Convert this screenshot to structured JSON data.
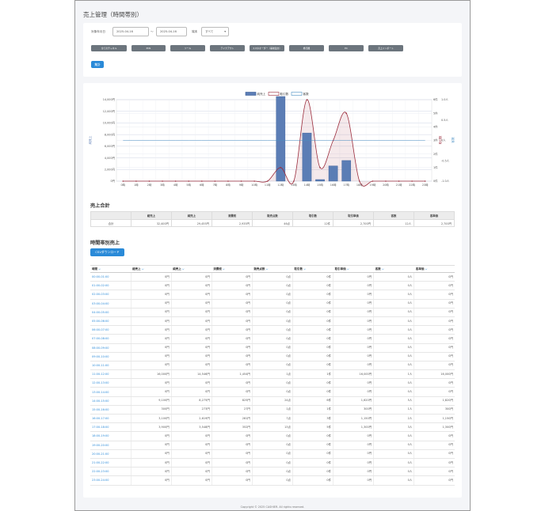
{
  "page": {
    "title": "売上管理（時間帯別）",
    "footer": "Copyright © 2025 CASHIER. All rights reserved."
  },
  "filters": {
    "date_label": "対象年月日",
    "date_from": "2025-04-16",
    "separator": "〜",
    "date_to": "2025-04-16",
    "store_label": "端末",
    "store_value": "すべて",
    "chips": [
      "全てのチャネル",
      "POS",
      "ツール",
      "テイクアウト",
      "スマホオーダー（事前注文）",
      "券売機",
      "EC",
      "売上インポート"
    ],
    "aggregate_button": "集計"
  },
  "chart_data": {
    "type": "bar",
    "categories": [
      "0時",
      "1時",
      "2時",
      "3時",
      "4時",
      "5時",
      "6時",
      "7時",
      "8時",
      "9時",
      "10時",
      "11時",
      "12時",
      "13時",
      "14時",
      "15時",
      "16時",
      "17時",
      "18時",
      "19時",
      "20時",
      "21時",
      "22時",
      "23時"
    ],
    "series": [
      {
        "name": "純売上",
        "type": "bar",
        "color": "#5b7db5",
        "values": [
          0,
          0,
          0,
          0,
          0,
          0,
          0,
          0,
          0,
          0,
          0,
          0,
          14546,
          0,
          8275,
          273,
          2619,
          3548,
          0,
          0,
          0,
          0,
          0,
          0
        ]
      },
      {
        "name": "取引数",
        "type": "line",
        "color": "#9b2c3c",
        "values": [
          0,
          0,
          0,
          0,
          0,
          0,
          0,
          0,
          0,
          0,
          0,
          0,
          1,
          0,
          6,
          1,
          3,
          5,
          0,
          0,
          0,
          0,
          0,
          0
        ]
      },
      {
        "name": "客数",
        "type": "line",
        "color": "#4a90c4",
        "values": [
          0,
          0,
          0,
          0,
          0,
          0,
          0,
          0,
          0,
          0,
          0,
          0,
          0,
          0,
          0,
          0,
          0,
          0,
          0,
          0,
          0,
          0,
          0,
          0
        ]
      }
    ],
    "legend_position": "top",
    "y_left": {
      "label": "純売上",
      "ticks": [
        "0円",
        "2,000円",
        "4,000円",
        "6,000円",
        "8,000円",
        "10,000円",
        "12,000円",
        "14,000円"
      ],
      "max": 14000
    },
    "y_right1": {
      "label": "取引数",
      "ticks": [
        "0件",
        "1件",
        "2件",
        "3件",
        "4件",
        "5件",
        "6件"
      ],
      "max": 6
    },
    "y_right2": {
      "label": "客数",
      "ticks": [
        "-1.0人",
        "-0.5人",
        "0人",
        "0.5人",
        "1.0人"
      ],
      "min": -1,
      "max": 1
    }
  },
  "summary": {
    "title": "売上合計",
    "headers": [
      "",
      "総売上",
      "純売上",
      "消費税",
      "販売点数",
      "取引数",
      "取引単価",
      "客数",
      "客単価"
    ],
    "row": [
      "合計",
      "32,400円",
      "29,455円",
      "2,935円",
      "46点",
      "12件",
      "2,700円",
      "12人",
      "2,700円"
    ]
  },
  "hourly": {
    "title": "時間帯別売上",
    "csv_button": "CSVダウンロード",
    "headers": [
      "時間",
      "総売上",
      "純売上",
      "消費税",
      "販売点数",
      "取引数",
      "取引単価",
      "客数",
      "客単価"
    ],
    "rows": [
      [
        "00:00-01:00",
        "0円",
        "0円",
        "0円",
        "0点",
        "0件",
        "0円",
        "0人",
        "0円"
      ],
      [
        "01:00-02:00",
        "0円",
        "0円",
        "0円",
        "0点",
        "0件",
        "0円",
        "0人",
        "0円"
      ],
      [
        "02:00-03:00",
        "0円",
        "0円",
        "0円",
        "0点",
        "0件",
        "0円",
        "0人",
        "0円"
      ],
      [
        "03:00-04:00",
        "0円",
        "0円",
        "0円",
        "0点",
        "0件",
        "0円",
        "0人",
        "0円"
      ],
      [
        "04:00-05:00",
        "0円",
        "0円",
        "0円",
        "0点",
        "0件",
        "0円",
        "0人",
        "0円"
      ],
      [
        "05:00-06:00",
        "0円",
        "0円",
        "0円",
        "0点",
        "0件",
        "0円",
        "0人",
        "0円"
      ],
      [
        "06:00-07:00",
        "0円",
        "0円",
        "0円",
        "0点",
        "0件",
        "0円",
        "0人",
        "0円"
      ],
      [
        "07:00-08:00",
        "0円",
        "0円",
        "0円",
        "0点",
        "0件",
        "0円",
        "0人",
        "0円"
      ],
      [
        "08:00-09:00",
        "0円",
        "0円",
        "0円",
        "0点",
        "0件",
        "0円",
        "0人",
        "0円"
      ],
      [
        "09:00-10:00",
        "0円",
        "0円",
        "0円",
        "0点",
        "0件",
        "0円",
        "0人",
        "0円"
      ],
      [
        "10:00-11:00",
        "0円",
        "0円",
        "0円",
        "0点",
        "0件",
        "0円",
        "0人",
        "0円"
      ],
      [
        "11:00-12:00",
        "16,000円",
        "14,546円",
        "1,454円",
        "1点",
        "1件",
        "16,000円",
        "1人",
        "16,000円"
      ],
      [
        "12:00-13:00",
        "0円",
        "0円",
        "0円",
        "0点",
        "0件",
        "0円",
        "0人",
        "0円"
      ],
      [
        "13:00-14:00",
        "0円",
        "0円",
        "0円",
        "0点",
        "0件",
        "0円",
        "0人",
        "0円"
      ],
      [
        "14:00-15:00",
        "9,100円",
        "8,275円",
        "825円",
        "24点",
        "6件",
        "1,620円",
        "5人",
        "1,820円"
      ],
      [
        "15:00-16:00",
        "300円",
        "273円",
        "27円",
        "1点",
        "1件",
        "300円",
        "1人",
        "300円"
      ],
      [
        "16:00-17:00",
        "3,100円",
        "2,619円",
        "281円",
        "7点",
        "3件",
        "1,150円",
        "2人",
        "1,150円"
      ],
      [
        "17:00-18:00",
        "3,900円",
        "3,548円",
        "352円",
        "13点",
        "5件",
        "1,300円",
        "3人",
        "1,300円"
      ],
      [
        "18:00-19:00",
        "0円",
        "0円",
        "0円",
        "0点",
        "0件",
        "0円",
        "0人",
        "0円"
      ],
      [
        "19:00-20:00",
        "0円",
        "0円",
        "0円",
        "0点",
        "0件",
        "0円",
        "0人",
        "0円"
      ],
      [
        "20:00-21:00",
        "0円",
        "0円",
        "0円",
        "0点",
        "0件",
        "0円",
        "0人",
        "0円"
      ],
      [
        "21:00-22:00",
        "0円",
        "0円",
        "0円",
        "0点",
        "0件",
        "0円",
        "0人",
        "0円"
      ],
      [
        "22:00-23:00",
        "0円",
        "0円",
        "0円",
        "0点",
        "0件",
        "0円",
        "0人",
        "0円"
      ],
      [
        "23:00-24:00",
        "0円",
        "0円",
        "0円",
        "0点",
        "0件",
        "0円",
        "0人",
        "0円"
      ]
    ]
  }
}
